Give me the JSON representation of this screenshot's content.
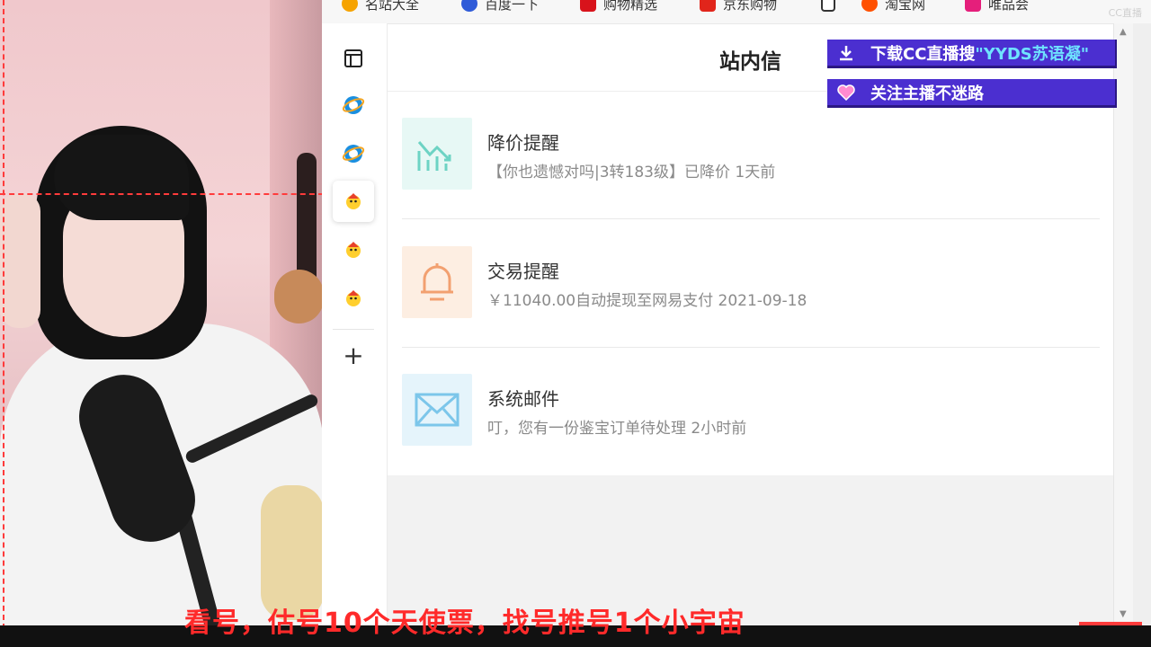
{
  "bookmarks": [
    {
      "label": "名站大全",
      "color": "#f6a300"
    },
    {
      "label": "百度一下",
      "color": "#2f5bd8"
    },
    {
      "label": "购物精选",
      "color": "#d8131b"
    },
    {
      "label": "京东购物",
      "color": "#e1251b"
    },
    {
      "label": "",
      "color": "#ffffff"
    },
    {
      "label": "淘宝网",
      "color": "#ff5000"
    },
    {
      "label": "唯品会",
      "color": "#e51f7b"
    }
  ],
  "sidebar": {
    "items": [
      {
        "icon": "panel-layout-icon"
      },
      {
        "icon": "browser-e-icon"
      },
      {
        "icon": "browser-e-icon"
      },
      {
        "icon": "chick-app-icon",
        "active": true
      },
      {
        "icon": "chick-app-icon"
      },
      {
        "icon": "chick-app-icon"
      }
    ],
    "add_label": "+"
  },
  "panel": {
    "title": "站内信",
    "messages": [
      {
        "title": "降价提醒",
        "desc": "【你也遗憾对吗|3转183级】已降价 1天前",
        "icon": "price-drop-icon",
        "bg": "#e7f8f5",
        "fg": "#6dd3c4"
      },
      {
        "title": "交易提醒",
        "desc": "￥11040.00自动提现至网易支付 2021-09-18",
        "icon": "bell-icon",
        "bg": "#fdeee2",
        "fg": "#f2a070"
      },
      {
        "title": "系统邮件",
        "desc": "叮，您有一份鉴宝订单待处理 2小时前",
        "icon": "mail-icon",
        "bg": "#e5f4fb",
        "fg": "#7cc6ea"
      }
    ]
  },
  "overlay": {
    "banner1_prefix": "下载CC直播搜 ",
    "banner1_highlight": "\"YYDS苏语凝\"",
    "banner2": "关注主播不迷路",
    "caption": "看号，估号10个天使票，找号推号1个小宇宙",
    "corner_logo": "CC直播"
  },
  "colors": {
    "banner": "#4b2fd0",
    "caption": "#ff2a2a"
  }
}
